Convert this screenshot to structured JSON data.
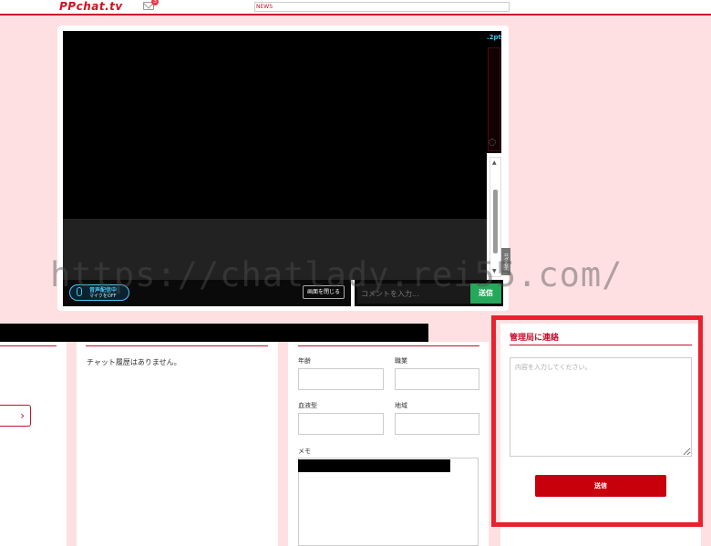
{
  "header": {
    "logo": "PPchat.tv",
    "mail_count": "3",
    "news_label": "NEWS"
  },
  "player": {
    "pt_label": ".2pt",
    "log_tab_label": "ログ表示",
    "mic_status_title": "音声配信中",
    "mic_status_sub": "マイクをOFF",
    "close_screen_label": "画面を閉じる",
    "comment_placeholder": "コメントを入力...",
    "send_label": "送信"
  },
  "history": {
    "empty_text": "チャット履歴はありません。"
  },
  "profile": {
    "age_label": "年齢",
    "job_label": "職業",
    "blood_label": "血液型",
    "region_label": "地域",
    "memo_label": "メモ"
  },
  "contact": {
    "title": "管理局に連絡",
    "placeholder": "内容を入力してください。",
    "send_label": "送信"
  },
  "watermark": "https://chatlady.rei55.com/",
  "colors": {
    "brand_red": "#c8102e",
    "background": "#ffe0e2",
    "send_green": "#26a85a",
    "mic_cyan": "#48c6ef",
    "highlight_red": "#e8222d"
  }
}
